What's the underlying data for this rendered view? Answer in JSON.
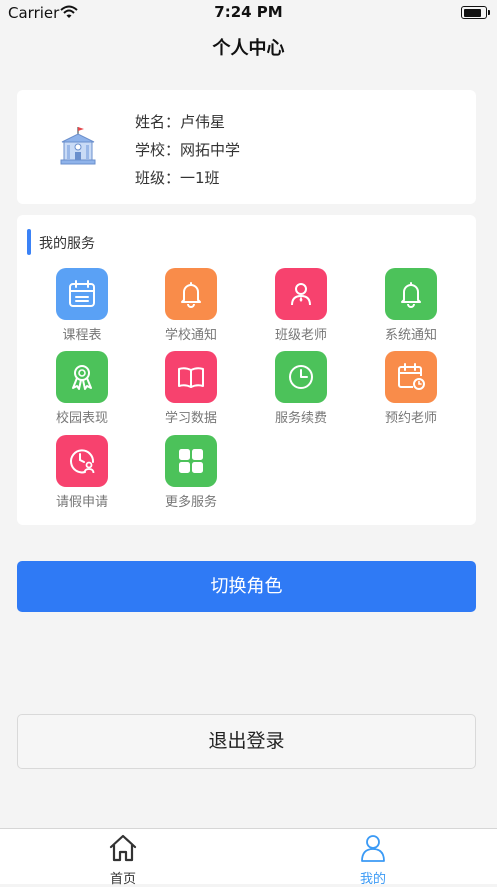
{
  "status_bar": {
    "carrier": "Carrier",
    "time": "7:24 PM"
  },
  "header": {
    "title": "个人中心"
  },
  "profile": {
    "logo_icon": "school-building-icon",
    "name_line": "姓名：卢伟星",
    "school_line": "学校：网拓中学",
    "class_line": "班级：一1班"
  },
  "services": {
    "title": "我的服务",
    "items": [
      {
        "label": "课程表",
        "icon": "calendar-icon",
        "color": "#5aa1f5"
      },
      {
        "label": "学校通知",
        "icon": "bell-icon",
        "color": "#f98c4a"
      },
      {
        "label": "班级老师",
        "icon": "teacher-icon",
        "color": "#f7426e"
      },
      {
        "label": "系统通知",
        "icon": "bell-icon",
        "color": "#4cc25a"
      },
      {
        "label": "校园表现",
        "icon": "award-icon",
        "color": "#4cc25a"
      },
      {
        "label": "学习数据",
        "icon": "book-icon",
        "color": "#f7426e"
      },
      {
        "label": "服务续费",
        "icon": "clock-icon",
        "color": "#4cc25a"
      },
      {
        "label": "预约老师",
        "icon": "calendar-clock-icon",
        "color": "#f98c4a"
      },
      {
        "label": "请假申请",
        "icon": "leave-clock-icon",
        "color": "#f7426e"
      },
      {
        "label": "更多服务",
        "icon": "grid-icon",
        "color": "#4cc25a"
      }
    ]
  },
  "actions": {
    "switch_role": "切换角色",
    "logout": "退出登录"
  },
  "tabbar": {
    "items": [
      {
        "label": "首页",
        "icon": "home-icon",
        "active": false
      },
      {
        "label": "我的",
        "icon": "user-icon",
        "active": true
      }
    ],
    "active_color": "#3b9af5",
    "inactive_color": "#333333"
  }
}
